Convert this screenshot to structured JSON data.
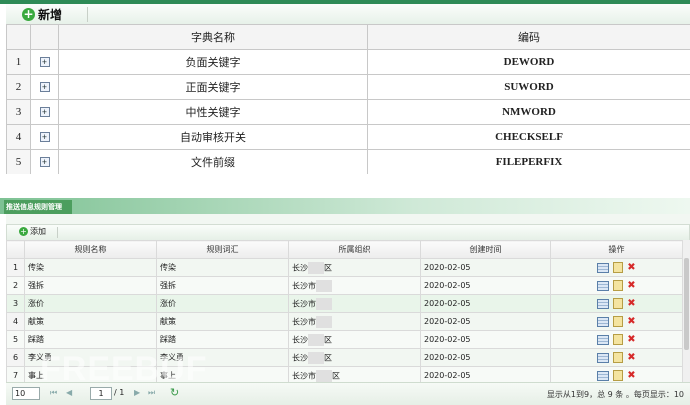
{
  "toolbar": {
    "add_label": "新增"
  },
  "dict_table": {
    "headers": {
      "name": "字典名称",
      "code": "编码"
    },
    "rows": [
      {
        "num": "1",
        "name": "负面关键字",
        "code": "DEWORD"
      },
      {
        "num": "2",
        "name": "正面关键字",
        "code": "SUWORD"
      },
      {
        "num": "3",
        "name": "中性关键字",
        "code": "NMWORD"
      },
      {
        "num": "4",
        "name": "自动审核开关",
        "code": "CHECKSELF"
      },
      {
        "num": "5",
        "name": "文件前缀",
        "code": "FILEPERFIX"
      }
    ]
  },
  "push_panel": {
    "title": "推送信息规则管理",
    "add_label": "添加",
    "headers": {
      "rule_name": "规则名称",
      "rule_word": "规则词汇",
      "org": "所属组织",
      "created": "创建时间",
      "op": "操作"
    },
    "rows": [
      {
        "num": "1",
        "rule_name": "传染",
        "rule_word": "传染",
        "org_a": "长沙",
        "org_b": "区",
        "created": "2020-02-05"
      },
      {
        "num": "2",
        "rule_name": "强拆",
        "rule_word": "强拆",
        "org_a": "长沙市",
        "org_b": "",
        "created": "2020-02-05"
      },
      {
        "num": "3",
        "rule_name": "涨价",
        "rule_word": "涨价",
        "org_a": "长沙市",
        "org_b": "",
        "created": "2020-02-05"
      },
      {
        "num": "4",
        "rule_name": "献策",
        "rule_word": "献策",
        "org_a": "长沙市",
        "org_b": "",
        "created": "2020-02-05"
      },
      {
        "num": "5",
        "rule_name": "踩踏",
        "rule_word": "踩踏",
        "org_a": "长沙",
        "org_b": "区",
        "created": "2020-02-05"
      },
      {
        "num": "6",
        "rule_name": "李义勇",
        "rule_word": "李义勇",
        "org_a": "长沙",
        "org_b": "区",
        "created": "2020-02-05"
      },
      {
        "num": "7",
        "rule_name": "事上",
        "rule_word": "事上",
        "org_a": "长沙市",
        "org_b": "区",
        "created": "2020-02-05"
      }
    ]
  },
  "pager": {
    "page_size": "10",
    "current_page": "1",
    "total_pages": "/ 1",
    "info": "显示从1到9，总 9 条 。每页显示：10"
  },
  "watermark": "FREEBUF"
}
